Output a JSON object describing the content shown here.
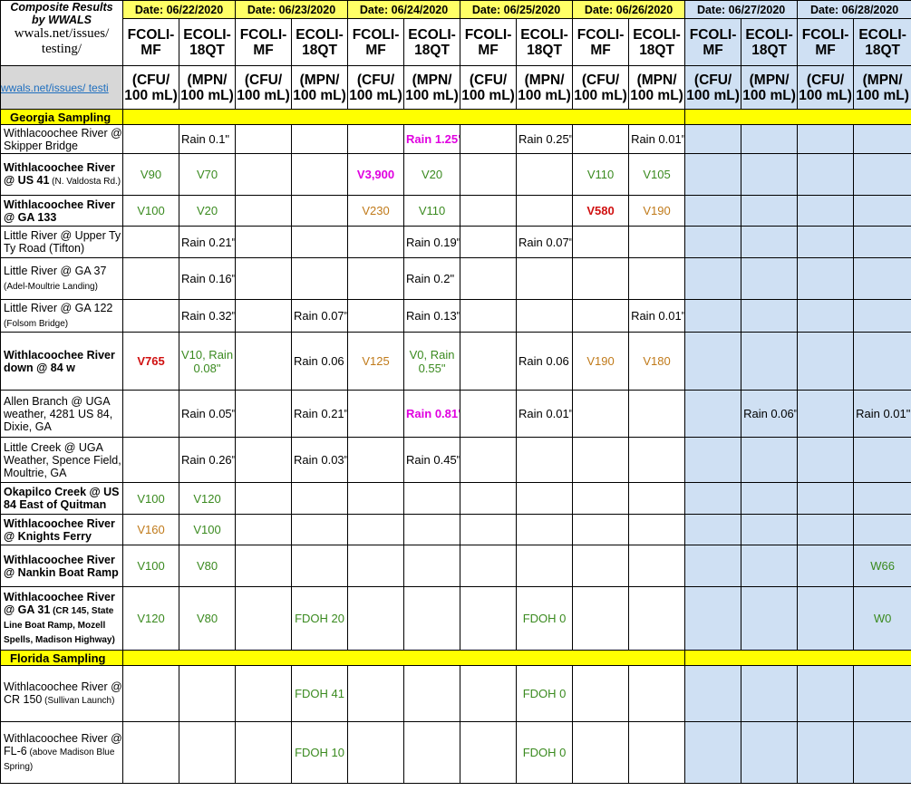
{
  "title": {
    "line1": "Composite Results",
    "line2": "by WWALS",
    "line3": "wwals.net/issues/",
    "line4": "testing/",
    "link": "wwals.net/issues/ testi"
  },
  "dates": [
    "Date: 06/22/2020",
    "Date: 06/23/2020",
    "Date: 06/24/2020",
    "Date: 06/25/2020",
    "Date: 06/26/2020",
    "Date: 06/27/2020",
    "Date: 06/28/2020"
  ],
  "columns": [
    "FCOLI-MF",
    "ECOLI-18QT"
  ],
  "units": [
    "(CFU/ 100 mL)",
    "(MPN/ 100 mL)"
  ],
  "sections": {
    "georgia": "Georgia Sampling",
    "florida": "Florida Sampling"
  },
  "rows": [
    {
      "site": "Withlacoochee River @ Skipper Bridge",
      "cells": [
        "",
        "Rain 0.1\"",
        "",
        "",
        "",
        "Rain 1.25\"",
        "",
        "Rain 0.25\"",
        "",
        "Rain 0.01\"",
        "",
        "",
        "",
        ""
      ]
    },
    {
      "site": "Withlacoochee River @ US 41",
      "site_note": "(N. Valdosta Rd.)",
      "cells": [
        "V90",
        "V70",
        "",
        "",
        "V3,900",
        "V20",
        "",
        "",
        "V110",
        "V105",
        "",
        "",
        "",
        ""
      ]
    },
    {
      "site": "Withlacoochee River @ GA 133",
      "cells": [
        "V100",
        "V20",
        "",
        "",
        "V230",
        "V110",
        "",
        "",
        "V580",
        "V190",
        "",
        "",
        "",
        ""
      ]
    },
    {
      "site": "Little River @ Upper Ty Ty Road (Tifton)",
      "cells": [
        "",
        "Rain 0.21\"",
        "",
        "",
        "",
        "Rain 0.19\"",
        "",
        "Rain 0.07\"",
        "",
        "",
        "",
        "",
        "",
        ""
      ]
    },
    {
      "site": "Little River @ GA 37",
      "site_note": "(Adel-Moultrie Landing)",
      "cells": [
        "",
        "Rain 0.16\"",
        "",
        "",
        "",
        "Rain 0.2\"",
        "",
        "",
        "",
        "",
        "",
        "",
        "",
        ""
      ]
    },
    {
      "site": "Little River @ GA 122",
      "site_note": "(Folsom Bridge)",
      "cells": [
        "",
        "Rain 0.32\"",
        "",
        "Rain 0.07\"",
        "",
        "Rain 0.13\"",
        "",
        "",
        "",
        "Rain 0.01\"",
        "",
        "",
        "",
        ""
      ]
    },
    {
      "site": "Withlacoochee River down @ 84 w",
      "cells": [
        "V765",
        "V10, Rain 0.08\"",
        "",
        "Rain 0.06",
        "V125",
        "V0, Rain 0.55\"",
        "",
        "Rain 0.06",
        "V190",
        "V180",
        "",
        "",
        "",
        ""
      ]
    },
    {
      "site": "Allen Branch @ UGA weather, 4281 US 84, Dixie, GA",
      "cells": [
        "",
        "Rain 0.05\"",
        "",
        "Rain 0.21\"",
        "",
        "Rain 0.81\"",
        "",
        "Rain 0.01\"",
        "",
        "",
        "",
        "Rain 0.06\"",
        "",
        "Rain 0.01\""
      ]
    },
    {
      "site": "Little Creek @ UGA Weather, Spence Field, Moultrie, GA",
      "cells": [
        "",
        "Rain 0.26\"",
        "",
        "Rain 0.03\"",
        "",
        "Rain 0.45\"",
        "",
        "",
        "",
        "",
        "",
        "",
        "",
        ""
      ]
    },
    {
      "site": "Okapilco Creek @ US 84 East of Quitman",
      "cells": [
        "V100",
        "V120",
        "",
        "",
        "",
        "",
        "",
        "",
        "",
        "",
        "",
        "",
        "",
        ""
      ]
    },
    {
      "site": "Withlacoochee River @ Knights Ferry",
      "cells": [
        "V160",
        "V100",
        "",
        "",
        "",
        "",
        "",
        "",
        "",
        "",
        "",
        "",
        "",
        ""
      ]
    },
    {
      "site": "Withlacoochee River @ Nankin Boat Ramp",
      "cells": [
        "V100",
        "V80",
        "",
        "",
        "",
        "",
        "",
        "",
        "",
        "",
        "",
        "",
        "",
        "W66"
      ]
    },
    {
      "site": "Withlacoochee River @ GA 31",
      "site_note": "(CR 145, State Line Boat Ramp, Mozell Spells, Madison Highway)",
      "cells": [
        "V120",
        "V80",
        "",
        "FDOH 20",
        "",
        "",
        "",
        "FDOH 0",
        "",
        "",
        "",
        "",
        "",
        "W0"
      ]
    }
  ],
  "florida_rows": [
    {
      "site": "Withlacoochee River @ CR 150",
      "site_note": "(Sullivan Launch)",
      "cells": [
        "",
        "",
        "",
        "FDOH 41",
        "",
        "",
        "",
        "FDOH 0",
        "",
        "",
        "",
        "",
        "",
        ""
      ]
    },
    {
      "site": "Withlacoochee River @ FL-6",
      "site_note": "(above Madison Blue Spring)",
      "cells": [
        "",
        "",
        "",
        "FDOH 10",
        "",
        "",
        "",
        "FDOH 0",
        "",
        "",
        "",
        "",
        "",
        ""
      ]
    }
  ],
  "colors": {
    "yellow": "#ffff00",
    "blue": "#cfe0f3",
    "green": "#3a8a1f",
    "orange": "#c07a1a",
    "red": "#d01010",
    "magenta": "#e000e0"
  }
}
